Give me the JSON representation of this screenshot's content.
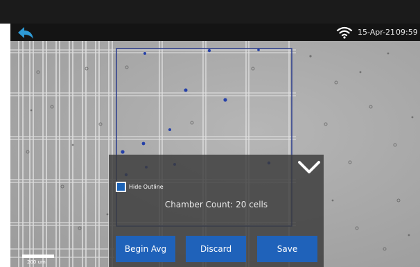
{
  "status_bar": {
    "date": "15-Apr-21",
    "time": "09:59",
    "back_icon": "back-arrow-icon",
    "wifi_icon": "wifi-icon"
  },
  "overlay": {
    "hide_outline_label": "Hide Outline",
    "hide_outline_checked": true,
    "chamber_count_text": "Chamber Count: 20 cells",
    "collapse_icon": "chevron-down-icon"
  },
  "buttons": {
    "begin_avg": "Begin Avg",
    "discard": "Discard",
    "save": "Save"
  },
  "image": {
    "scale_bar_label": "200 um"
  },
  "colors": {
    "accent": "#1f62ba",
    "panel": "#3a3a3a",
    "outline": "#2a3c8c",
    "cell_stain": "#2540a8"
  }
}
